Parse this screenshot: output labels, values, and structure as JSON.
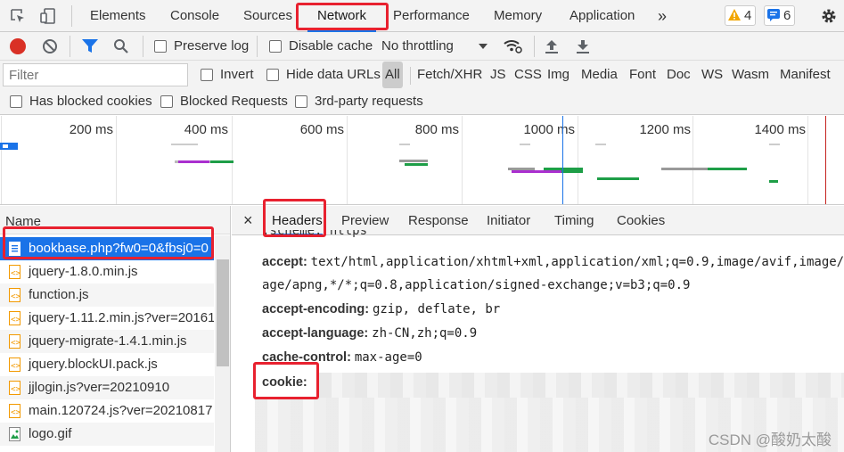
{
  "tabs": {
    "items": [
      "Elements",
      "Console",
      "Sources",
      "Network",
      "Performance",
      "Memory",
      "Application"
    ],
    "active": "Network",
    "more": "»",
    "warnings_count": "4",
    "messages_count": "6"
  },
  "toolbar": {
    "preserve_log": "Preserve log",
    "disable_cache": "Disable cache",
    "throttling": "No throttling"
  },
  "filter": {
    "placeholder": "Filter",
    "invert": "Invert",
    "hide_data_urls": "Hide data URLs",
    "types": [
      "All",
      "Fetch/XHR",
      "JS",
      "CSS",
      "Img",
      "Media",
      "Font",
      "Doc",
      "WS",
      "Wasm",
      "Manifest"
    ]
  },
  "blocked": {
    "has_blocked_cookies": "Has blocked cookies",
    "blocked_requests": "Blocked Requests",
    "third_party": "3rd-party requests"
  },
  "overview": {
    "ticks": [
      "200 ms",
      "400 ms",
      "600 ms",
      "800 ms",
      "1000 ms",
      "1200 ms",
      "1400 ms"
    ]
  },
  "requests": {
    "header": "Name",
    "items": [
      {
        "name": "bookbase.php?fw0=0&fbsj0=0",
        "type": "doc"
      },
      {
        "name": "jquery-1.8.0.min.js",
        "type": "script"
      },
      {
        "name": "function.js",
        "type": "script"
      },
      {
        "name": "jquery-1.11.2.min.js?ver=20161",
        "type": "script"
      },
      {
        "name": "jquery-migrate-1.4.1.min.js",
        "type": "script"
      },
      {
        "name": "jquery.blockUI.pack.js",
        "type": "script"
      },
      {
        "name": "jjlogin.js?ver=20210910",
        "type": "script"
      },
      {
        "name": "main.120724.js?ver=20210817",
        "type": "script"
      },
      {
        "name": "logo.gif",
        "type": "image"
      }
    ]
  },
  "details": {
    "close": "×",
    "tabs": [
      "Headers",
      "Preview",
      "Response",
      "Initiator",
      "Timing",
      "Cookies"
    ],
    "active": "Headers",
    "scheme_partial": ":scheme: https",
    "headers": [
      {
        "key": "accept:",
        "value": "text/html,application/xhtml+xml,application/xml;q=0.9,image/avif,image/we"
      },
      {
        "key": "",
        "value": "age/apng,*/*;q=0.8,application/signed-exchange;v=b3;q=0.9"
      },
      {
        "key": "accept-encoding:",
        "value": "gzip, deflate, br"
      },
      {
        "key": "accept-language:",
        "value": "zh-CN,zh;q=0.9"
      },
      {
        "key": "cache-control:",
        "value": "max-age=0"
      },
      {
        "key": "cookie:",
        "value": ""
      }
    ]
  },
  "watermark": "CSDN @酸奶太酸",
  "colors": {
    "accent": "#1a73e8",
    "highlight": "#e8212f",
    "record": "#d93025"
  }
}
